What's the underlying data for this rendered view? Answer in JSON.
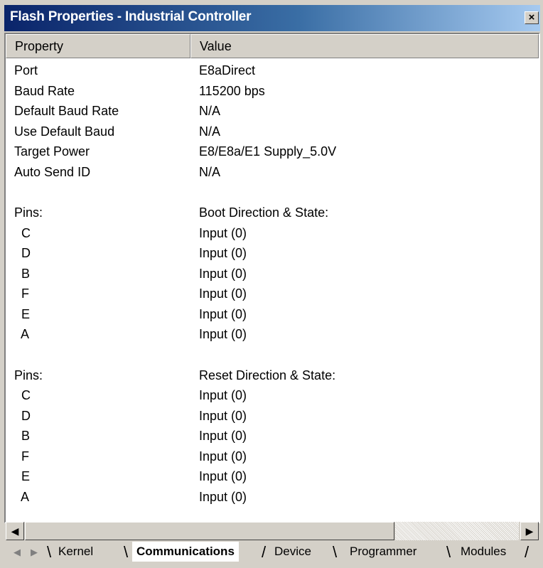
{
  "window": {
    "title": "Flash Properties - Industrial Controller",
    "close_symbol": "×"
  },
  "columns": {
    "property": "Property",
    "value": "Value"
  },
  "rows": [
    {
      "property": "Port",
      "value": "E8aDirect"
    },
    {
      "property": "Baud Rate",
      "value": "115200 bps"
    },
    {
      "property": "Default Baud Rate",
      "value": "N/A"
    },
    {
      "property": "Use Default Baud",
      "value": "N/A"
    },
    {
      "property": "Target Power",
      "value": "E8/E8a/E1 Supply_5.0V"
    },
    {
      "property": "Auto Send ID",
      "value": "N/A"
    },
    {
      "property": "",
      "value": ""
    },
    {
      "property": "Pins:",
      "value": "Boot Direction & State:"
    },
    {
      "property": "  C",
      "value": "Input (0)"
    },
    {
      "property": "  D",
      "value": "Input (0)"
    },
    {
      "property": "  B",
      "value": "Input (0)"
    },
    {
      "property": "  F",
      "value": "Input (0)"
    },
    {
      "property": "  E",
      "value": "Input (0)"
    },
    {
      "property": "  A",
      "value": "Input (0)"
    },
    {
      "property": "",
      "value": ""
    },
    {
      "property": "Pins:",
      "value": "Reset Direction & State:"
    },
    {
      "property": "  C",
      "value": "Input (0)"
    },
    {
      "property": "  D",
      "value": "Input (0)"
    },
    {
      "property": "  B",
      "value": "Input (0)"
    },
    {
      "property": "  F",
      "value": "Input (0)"
    },
    {
      "property": "  E",
      "value": "Input (0)"
    },
    {
      "property": "  A",
      "value": "Input (0)"
    }
  ],
  "scrollbar": {
    "left_arrow": "◀",
    "right_arrow": "▶"
  },
  "tabs": {
    "nav_first": "◀",
    "nav_prev": "▶",
    "items": [
      {
        "label": "Kernel",
        "active": false
      },
      {
        "label": "Communications",
        "active": true
      },
      {
        "label": "Device",
        "active": false
      },
      {
        "label": "Programmer",
        "active": false
      },
      {
        "label": "Modules",
        "active": false
      }
    ]
  }
}
